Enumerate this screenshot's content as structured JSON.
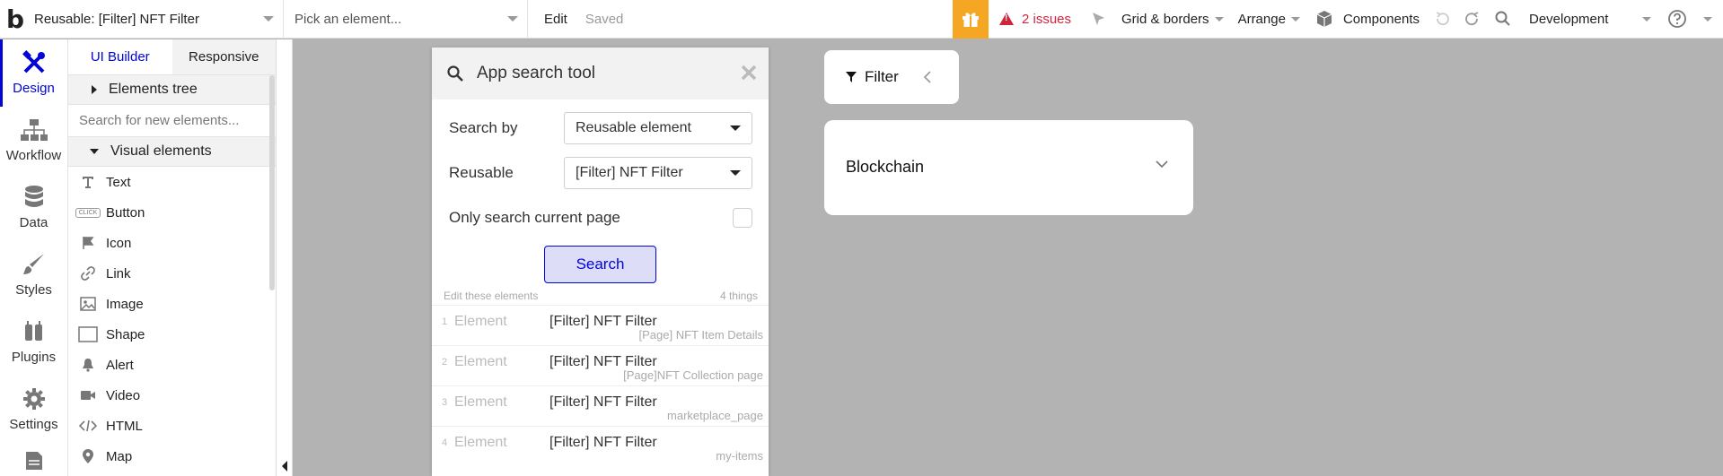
{
  "topbar": {
    "logo": "b",
    "page_select": "Reusable: [Filter] NFT Filter",
    "element_select_placeholder": "Pick an element...",
    "edit": "Edit",
    "saved": "Saved",
    "issues": "2 issues",
    "grid_borders": "Grid & borders",
    "arrange": "Arrange",
    "components": "Components",
    "environment": "Development",
    "accent_color": "#f5a623",
    "issue_color": "#d0243c"
  },
  "rail": {
    "items": [
      {
        "label": "Design",
        "icon": "design-icon"
      },
      {
        "label": "Workflow",
        "icon": "workflow-icon"
      },
      {
        "label": "Data",
        "icon": "database-icon"
      },
      {
        "label": "Styles",
        "icon": "brush-icon"
      },
      {
        "label": "Plugins",
        "icon": "plug-icon"
      },
      {
        "label": "Settings",
        "icon": "gear-icon"
      }
    ],
    "active_color": "#0205d3"
  },
  "panel": {
    "tabs": [
      "UI Builder",
      "Responsive"
    ],
    "elements_tree": "Elements tree",
    "search_placeholder": "Search for new elements...",
    "visual_elements": "Visual elements",
    "items": [
      {
        "label": "Text",
        "icon": "text-icon"
      },
      {
        "label": "Button",
        "icon": "button-icon",
        "badge": "CLICK"
      },
      {
        "label": "Icon",
        "icon": "flag-icon"
      },
      {
        "label": "Link",
        "icon": "link-icon"
      },
      {
        "label": "Image",
        "icon": "image-icon"
      },
      {
        "label": "Shape",
        "icon": "shape-icon"
      },
      {
        "label": "Alert",
        "icon": "bell-icon"
      },
      {
        "label": "Video",
        "icon": "video-icon"
      },
      {
        "label": "HTML",
        "icon": "code-icon"
      },
      {
        "label": "Map",
        "icon": "map-pin-icon"
      }
    ]
  },
  "search_tool": {
    "title": "App search tool",
    "search_by_label": "Search by",
    "search_by_value": "Reusable element",
    "reusable_label": "Reusable",
    "reusable_value": "[Filter] NFT Filter",
    "only_current_label": "Only search current page",
    "search_button": "Search",
    "edit_hint": "Edit these elements",
    "count": "4 things",
    "results": [
      {
        "num": "1",
        "type": "Element",
        "name": "[Filter] NFT Filter",
        "page": "[Page] NFT Item Details"
      },
      {
        "num": "2",
        "type": "Element",
        "name": "[Filter] NFT Filter",
        "page": "[Page]NFT Collection page"
      },
      {
        "num": "3",
        "type": "Element",
        "name": "[Filter] NFT Filter",
        "page": "marketplace_page"
      },
      {
        "num": "4",
        "type": "Element",
        "name": "[Filter] NFT Filter",
        "page": "my-items"
      }
    ]
  },
  "canvas": {
    "filter_label": "Filter",
    "blockchain_label": "Blockchain",
    "background": "#b3b3b3"
  }
}
